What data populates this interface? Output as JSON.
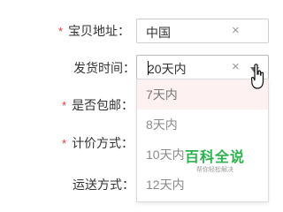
{
  "form": {
    "address": {
      "required_mark": "*",
      "label": "宝贝地址：",
      "value": "中国",
      "clear_icon": "×"
    },
    "ship_time": {
      "label": "发货时间：",
      "value": "20天内",
      "clear_icon": "×"
    },
    "free_shipping": {
      "required_mark": "*",
      "label": "是否包邮："
    },
    "pricing": {
      "required_mark": "*",
      "label": "计价方式："
    },
    "shipping_method": {
      "label": "运送方式："
    }
  },
  "dropdown": {
    "options": [
      "7天内",
      "8天内",
      "10天内",
      "12天内"
    ],
    "highlighted_index": 0
  },
  "watermark": {
    "title": "百科全说",
    "subtitle": "帮你轻松解决"
  },
  "colors": {
    "required": "#e4393c",
    "highlight": "#fdf2f1",
    "watermark": "#2bb24c"
  },
  "icons": {
    "field_clear": "close-icon",
    "dropdown_toggle": "chevron-down-icon",
    "pointer": "hand-cursor-icon"
  }
}
